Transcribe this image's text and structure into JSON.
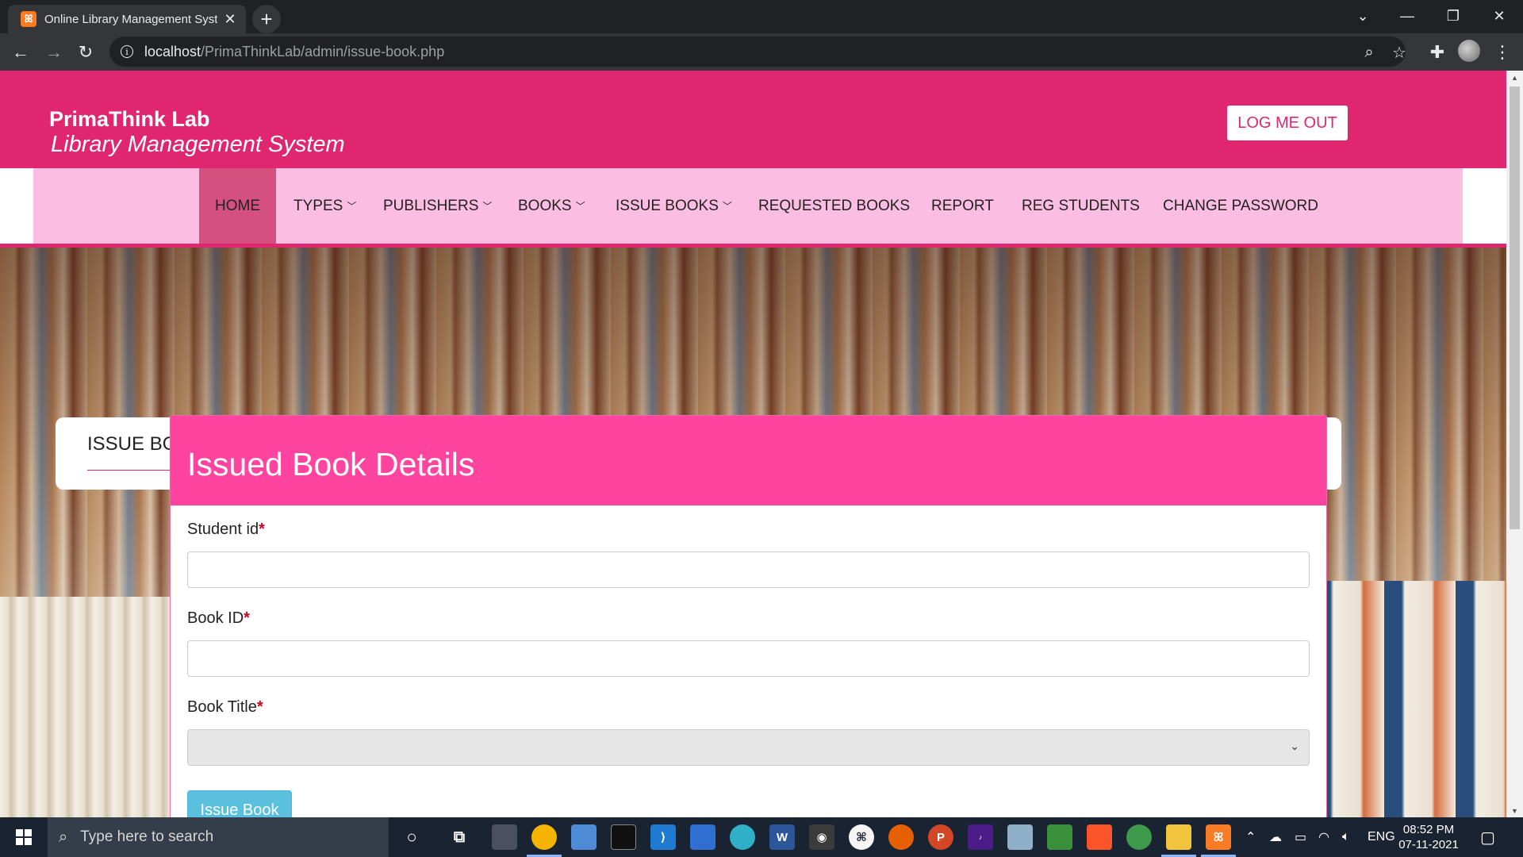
{
  "browser": {
    "tab_title": "Online Library Management System",
    "url_host": "localhost",
    "url_path": "/PrimaThinkLab/admin/issue-book.php"
  },
  "header": {
    "brand_name": "PrimaThink Lab",
    "brand_subtitle": "Library Management System",
    "logout_label": "LOG ME OUT"
  },
  "nav": {
    "items": [
      {
        "label": "HOME"
      },
      {
        "label": "TYPES"
      },
      {
        "label": "PUBLISHERS"
      },
      {
        "label": "BOOKS"
      },
      {
        "label": "ISSUE BOOKS"
      },
      {
        "label": "REQUESTED BOOKS"
      },
      {
        "label": "REPORT"
      },
      {
        "label": "REG STUDENTS"
      },
      {
        "label": "CHANGE PASSWORD"
      }
    ]
  },
  "page": {
    "section_title": "ISSUE BOOK",
    "form_title": "Issued Book Details",
    "fields": {
      "student_id_label": "Student id",
      "book_id_label": "Book ID",
      "book_title_label": "Book Title",
      "required_marker": "*"
    },
    "submit_label": "Issue Book"
  },
  "taskbar": {
    "search_placeholder": "Type here to search",
    "language": "ENG",
    "time": "08:52 PM",
    "date": "07-11-2021"
  },
  "colors": {
    "header_pink": "#e0266e",
    "nav_pink": "#fcbde2",
    "form_head_pink": "#ff44a0",
    "button_blue": "#5bc0de"
  }
}
